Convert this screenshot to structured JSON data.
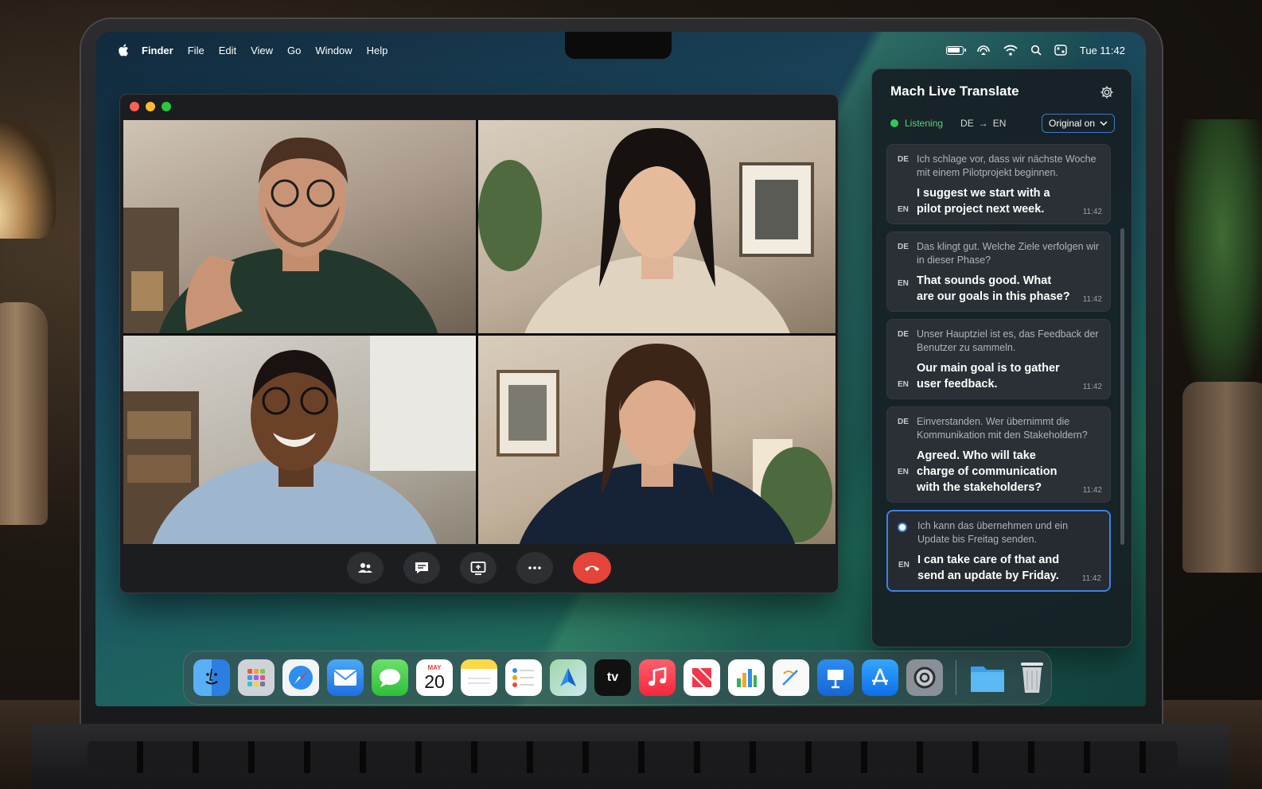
{
  "menubar": {
    "app_name": "Finder",
    "items": [
      "File",
      "Edit",
      "View",
      "Go",
      "Window",
      "Help"
    ],
    "clock": "Tue 11:42"
  },
  "video_call": {
    "controls": [
      "participants-icon",
      "chat-icon",
      "screen-share-icon",
      "more-icon",
      "end-call-icon"
    ]
  },
  "translate_panel": {
    "title": "Mach Live Translate",
    "status": "Listening",
    "source_lang": "DE",
    "arrow": "→",
    "target_lang": "EN",
    "mode_label": "Original on",
    "entries": [
      {
        "src_tag": "DE",
        "src": "Ich schlage vor, dass wir nächste Woche mit einem Pilotprojekt beginnen.",
        "tgt_tag": "EN",
        "tgt": "I suggest we start with a pilot project next week.",
        "time": "11:42"
      },
      {
        "src_tag": "DE",
        "src": "Das klingt gut. Welche Ziele verfolgen wir in dieser Phase?",
        "tgt_tag": "EN",
        "tgt": "That sounds good. What are our goals in this phase?",
        "time": "11:42"
      },
      {
        "src_tag": "DE",
        "src": "Unser Hauptziel ist es, das Feedback der Benutzer zu sammeln.",
        "tgt_tag": "EN",
        "tgt": "Our main goal is to gather user feedback.",
        "time": "11:42"
      },
      {
        "src_tag": "DE",
        "src": "Einverstanden. Wer übernimmt die Kommunikation mit den Stakeholdern?",
        "tgt_tag": "EN",
        "tgt": "Agreed. Who will take charge of communication with the stakeholders?",
        "time": "11:42"
      },
      {
        "src_tag": "",
        "src": "Ich kann das übernehmen und ein Update bis Freitag senden.",
        "tgt_tag": "EN",
        "tgt": "I can take care of that and send an update by Friday.",
        "time": "11:42"
      }
    ]
  },
  "dock": {
    "calendar_month": "MAY",
    "calendar_day": "20",
    "tv_label": "tv",
    "apps": [
      "finder",
      "launchpad",
      "safari",
      "mail",
      "messages",
      "calendar",
      "notes",
      "reminders",
      "maps",
      "apple-tv",
      "music",
      "news",
      "numbers",
      "freeform",
      "keynote",
      "app-store",
      "system-settings",
      "folder",
      "trash"
    ]
  },
  "colors": {
    "accent_blue": "#3e82e6",
    "listening_green": "#34c759",
    "end_call_red": "#e5443b"
  }
}
